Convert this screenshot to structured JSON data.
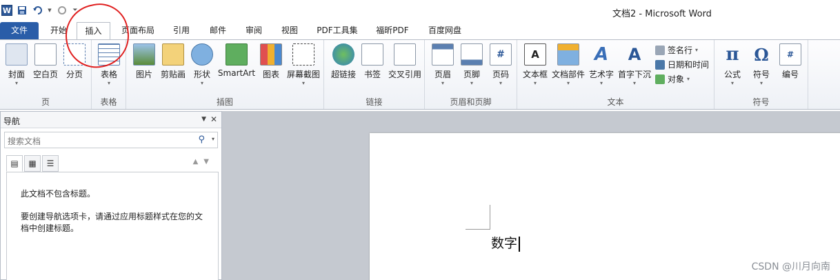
{
  "title_bar": {
    "app_icon_label": "W",
    "title": "文档2 - Microsoft Word"
  },
  "tabs": [
    {
      "label": "文件"
    },
    {
      "label": "开始"
    },
    {
      "label": "插入"
    },
    {
      "label": "页面布局"
    },
    {
      "label": "引用"
    },
    {
      "label": "邮件"
    },
    {
      "label": "审阅"
    },
    {
      "label": "视图"
    },
    {
      "label": "PDF工具集"
    },
    {
      "label": "福昕PDF"
    },
    {
      "label": "百度网盘"
    }
  ],
  "ribbon": {
    "groups": [
      {
        "label": "页",
        "buttons": [
          "封面",
          "空白页",
          "分页"
        ]
      },
      {
        "label": "表格",
        "buttons": [
          "表格"
        ]
      },
      {
        "label": "插图",
        "buttons": [
          "图片",
          "剪贴画",
          "形状",
          "SmartArt",
          "图表",
          "屏幕截图"
        ]
      },
      {
        "label": "链接",
        "buttons": [
          "超链接",
          "书签",
          "交叉引用"
        ]
      },
      {
        "label": "页眉和页脚",
        "buttons": [
          "页眉",
          "页脚",
          "页码"
        ]
      },
      {
        "label": "文本",
        "buttons": [
          "文本框",
          "文档部件",
          "艺术字",
          "首字下沉"
        ],
        "small_buttons": [
          "签名行",
          "日期和时间",
          "对象"
        ]
      },
      {
        "label": "符号",
        "buttons": [
          "公式",
          "符号",
          "编号"
        ]
      }
    ]
  },
  "nav_pane": {
    "title": "导航",
    "search_placeholder": "搜索文档",
    "message_1": "此文档不包含标题。",
    "message_2": "要创建导航选项卡，请通过应用标题样式在您的文档中创建标题。"
  },
  "document": {
    "text": "数字"
  },
  "watermark": "CSDN @川月向南",
  "colors": {
    "file_tab": "#2a5da8",
    "annotation_circle": "#e02020",
    "doc_background": "#c5c9d0"
  }
}
